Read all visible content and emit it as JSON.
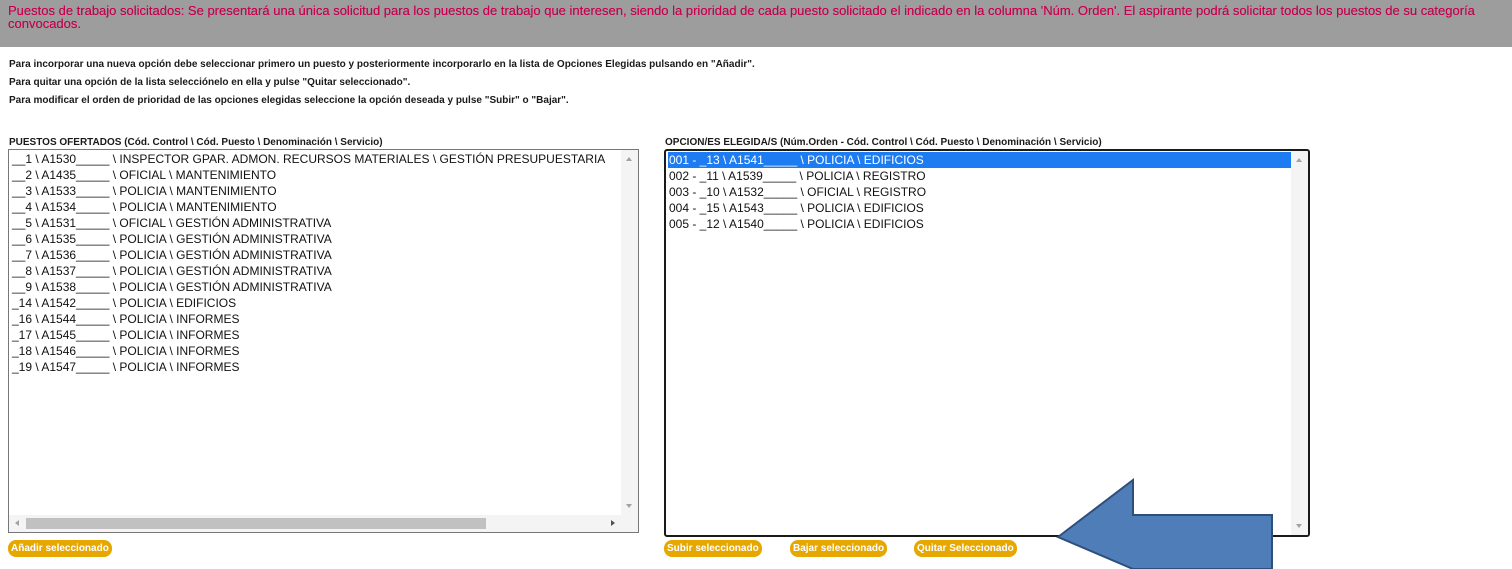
{
  "banner": {
    "text": "Puestos de trabajo solicitados: Se presentará una única solicitud para los puestos de trabajo que interesen, siendo la prioridad de cada puesto solicitado el indicado en la columna 'Núm. Orden'. El aspirante podrá solicitar todos los puestos de su categoría convocados."
  },
  "instructions": [
    "Para incorporar una nueva opción debe seleccionar primero un puesto y posteriormente incorporarlo en la lista de Opciones Elegidas pulsando en \"Añadir\".",
    "Para quitar una opción de la lista selecciónelo en ella y pulse \"Quitar seleccionado\".",
    "Para modificar el orden de prioridad de las opciones elegidas seleccione la opción deseada  y pulse \"Subir\" o \"Bajar\"."
  ],
  "offered": {
    "title": "PUESTOS OFERTADOS (Cód. Control \\ Cód. Puesto \\ Denominación \\ Servicio)",
    "items": [
      "__1 \\ A1530_____ \\ INSPECTOR GPAR. ADMON. RECURSOS MATERIALES \\ GESTIÓN PRESUPUESTARIA",
      "__2 \\ A1435_____ \\ OFICIAL \\ MANTENIMIENTO",
      "__3 \\ A1533_____ \\ POLICIA \\ MANTENIMIENTO",
      "__4 \\ A1534_____ \\ POLICIA \\ MANTENIMIENTO",
      "__5 \\ A1531_____ \\ OFICIAL \\ GESTIÓN ADMINISTRATIVA",
      "__6 \\ A1535_____ \\ POLICIA \\ GESTIÓN ADMINISTRATIVA",
      "__7 \\ A1536_____ \\ POLICIA \\ GESTIÓN ADMINISTRATIVA",
      "__8 \\ A1537_____ \\ POLICIA \\ GESTIÓN ADMINISTRATIVA",
      "__9 \\ A1538_____ \\ POLICIA \\ GESTIÓN ADMINISTRATIVA",
      "_14 \\ A1542_____ \\ POLICIA \\ EDIFICIOS",
      "_16 \\ A1544_____ \\ POLICIA \\ INFORMES",
      "_17 \\ A1545_____ \\ POLICIA \\ INFORMES",
      "_18 \\ A1546_____ \\ POLICIA \\ INFORMES",
      "_19 \\ A1547_____ \\ POLICIA \\ INFORMES"
    ]
  },
  "chosen": {
    "title": "OPCION/ES ELEGIDA/S (Núm.Orden - Cód. Control \\ Cód. Puesto \\ Denominación \\ Servicio)",
    "items": [
      "001 - _13 \\ A1541_____ \\ POLICIA \\ EDIFICIOS",
      "002 - _11 \\ A1539_____ \\ POLICIA \\ REGISTRO",
      "003 - _10 \\ A1532_____ \\ OFICIAL \\ REGISTRO",
      "004 - _15 \\ A1543_____ \\ POLICIA \\ EDIFICIOS",
      "005 - _12 \\ A1540_____ \\ POLICIA \\ EDIFICIOS"
    ],
    "selected_index": 0
  },
  "buttons": {
    "add": "Añadir seleccionado",
    "up": "Subir seleccionado",
    "down": "Bajar seleccionado",
    "remove": "Quitar Seleccionado"
  },
  "colors": {
    "banner_bg": "#9d9d9d",
    "banner_text": "#c80050",
    "button_bg": "#e6a800",
    "selection": "#1e7cf2",
    "callout_arrow": "#4f7db8"
  }
}
